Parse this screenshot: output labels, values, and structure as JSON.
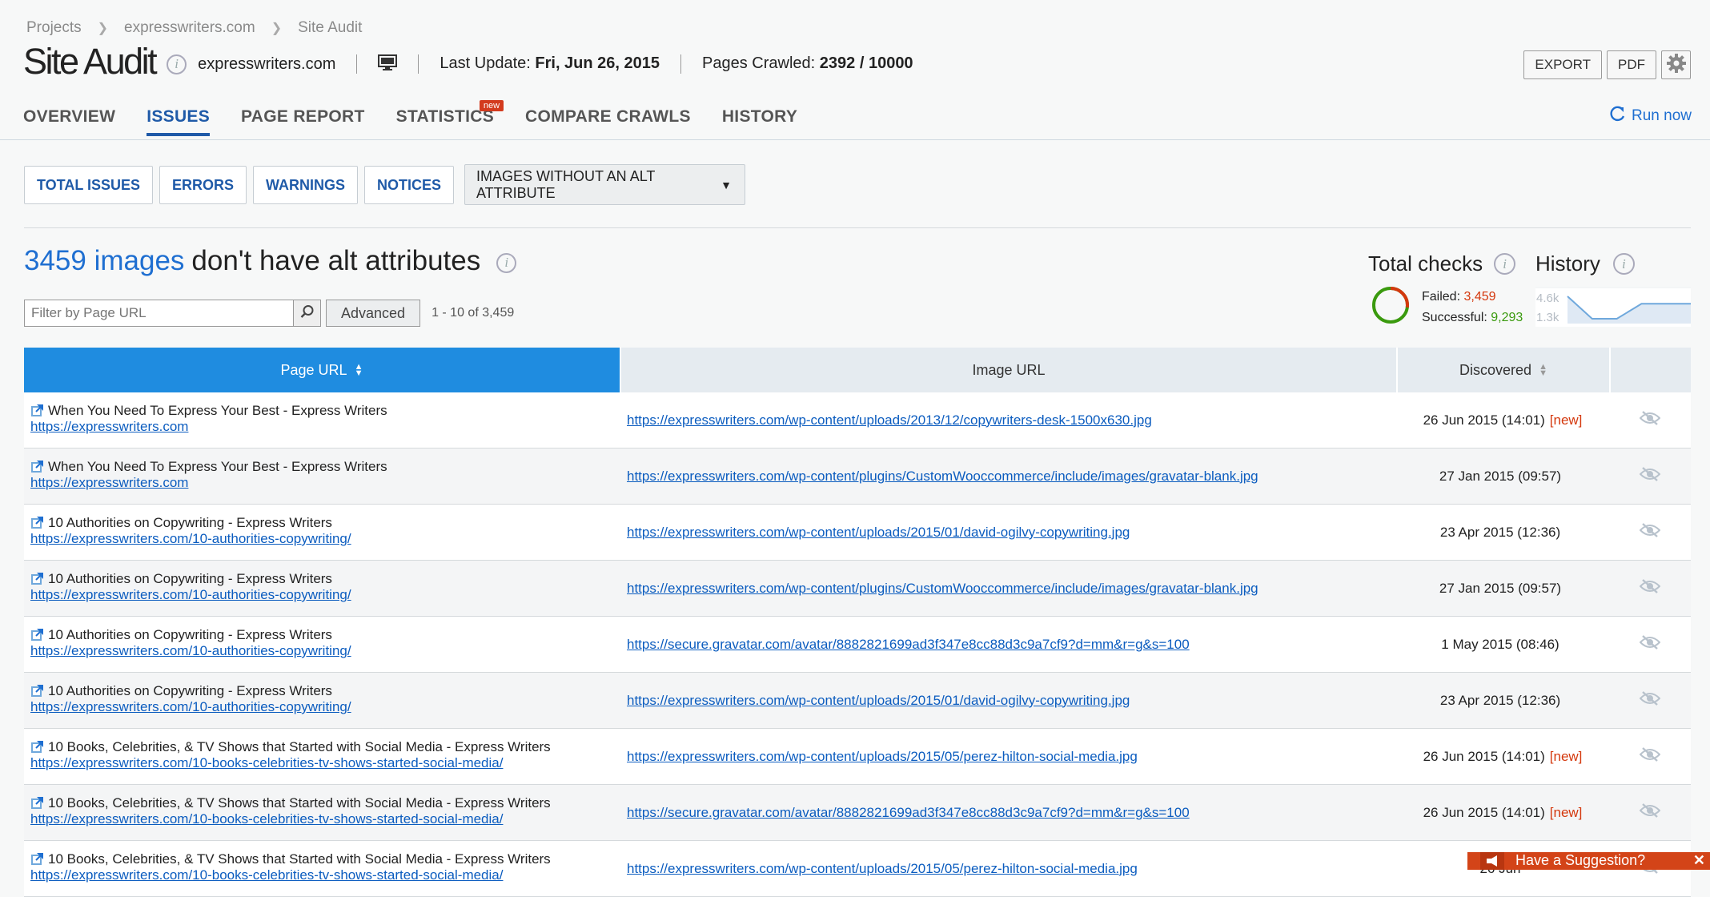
{
  "breadcrumb": [
    "Projects",
    "expresswriters.com",
    "Site Audit"
  ],
  "header": {
    "title": "Site Audit",
    "domain": "expresswriters.com",
    "last_update_label": "Last Update:",
    "last_update_value": "Fri, Jun 26, 2015",
    "pages_crawled_label": "Pages Crawled:",
    "pages_crawled_value": "2392 / 10000"
  },
  "actions": {
    "export": "EXPORT",
    "pdf": "PDF"
  },
  "tabs": [
    {
      "label": "OVERVIEW"
    },
    {
      "label": "ISSUES",
      "active": true
    },
    {
      "label": "PAGE REPORT"
    },
    {
      "label": "STATISTICS",
      "badge": "new"
    },
    {
      "label": "COMPARE CRAWLS"
    },
    {
      "label": "HISTORY"
    }
  ],
  "run_now": "Run now",
  "filters": [
    "TOTAL ISSUES",
    "ERRORS",
    "WARNINGS",
    "NOTICES"
  ],
  "issue_select": "IMAGES WITHOUT AN ALT ATTRIBUTE",
  "headline": {
    "count": "3459 images",
    "text": "don't have alt attributes"
  },
  "search": {
    "placeholder": "Filter by Page URL",
    "advanced": "Advanced",
    "pager": "1 - 10 of 3,459"
  },
  "total_checks": {
    "title": "Total checks",
    "failed_label": "Failed:",
    "failed_value": "3,459",
    "successful_label": "Successful:",
    "successful_value": "9,293",
    "failed": 3459,
    "successful": 9293
  },
  "history": {
    "title": "History",
    "y_top": "4.6k",
    "y_bottom": "1.3k",
    "chart_data": {
      "type": "area",
      "values": [
        4.6,
        1.3,
        1.3,
        3.5,
        3.5,
        3.5
      ],
      "ylim": [
        1.3,
        4.6
      ]
    }
  },
  "table": {
    "columns": [
      "Page URL",
      "Image URL",
      "Discovered"
    ],
    "rows": [
      {
        "title": "When You Need To Express Your Best - Express Writers",
        "url": "https://expresswriters.com",
        "image": "https://expresswriters.com/wp-content/uploads/2013/12/copywriters-desk-1500x630.jpg",
        "date": "26 Jun 2015 (14:01)",
        "new": "[new]"
      },
      {
        "title": "When You Need To Express Your Best - Express Writers",
        "url": "https://expresswriters.com",
        "image": "https://expresswriters.com/wp-content/plugins/CustomWooccommerce/include/images/gravatar-blank.jpg",
        "date": "27 Jan 2015 (09:57)",
        "new": ""
      },
      {
        "title": "10 Authorities on Copywriting - Express Writers",
        "url": "https://expresswriters.com/10-authorities-copywriting/",
        "image": "https://expresswriters.com/wp-content/uploads/2015/01/david-ogilvy-copywriting.jpg",
        "date": "23 Apr 2015 (12:36)",
        "new": ""
      },
      {
        "title": "10 Authorities on Copywriting - Express Writers",
        "url": "https://expresswriters.com/10-authorities-copywriting/",
        "image": "https://expresswriters.com/wp-content/plugins/CustomWooccommerce/include/images/gravatar-blank.jpg",
        "date": "27 Jan 2015 (09:57)",
        "new": ""
      },
      {
        "title": "10 Authorities on Copywriting - Express Writers",
        "url": "https://expresswriters.com/10-authorities-copywriting/",
        "image": "https://secure.gravatar.com/avatar/8882821699ad3f347e8cc88d3c9a7cf9?d=mm&r=g&s=100",
        "date": "1 May 2015 (08:46)",
        "new": ""
      },
      {
        "title": "10 Authorities on Copywriting - Express Writers",
        "url": "https://expresswriters.com/10-authorities-copywriting/",
        "image": "https://expresswriters.com/wp-content/uploads/2015/01/david-ogilvy-copywriting.jpg",
        "date": "23 Apr 2015 (12:36)",
        "new": ""
      },
      {
        "title": "10 Books, Celebrities, & TV Shows that Started with Social Media - Express Writers",
        "url": "https://expresswriters.com/10-books-celebrities-tv-shows-started-social-media/",
        "image": "https://expresswriters.com/wp-content/uploads/2015/05/perez-hilton-social-media.jpg",
        "date": "26 Jun 2015 (14:01)",
        "new": "[new]"
      },
      {
        "title": "10 Books, Celebrities, & TV Shows that Started with Social Media - Express Writers",
        "url": "https://expresswriters.com/10-books-celebrities-tv-shows-started-social-media/",
        "image": "https://secure.gravatar.com/avatar/8882821699ad3f347e8cc88d3c9a7cf9?d=mm&r=g&s=100",
        "date": "26 Jun 2015 (14:01)",
        "new": "[new]"
      },
      {
        "title": "10 Books, Celebrities, & TV Shows that Started with Social Media - Express Writers",
        "url": "https://expresswriters.com/10-books-celebrities-tv-shows-started-social-media/",
        "image": "https://expresswriters.com/wp-content/uploads/2015/05/perez-hilton-social-media.jpg",
        "date": "26 Jun",
        "new": ""
      }
    ]
  },
  "suggestion": "Have a Suggestion?",
  "colors": {
    "accent": "#1f8ce0",
    "tab_active": "#1f5aa8",
    "failed": "#d4380d",
    "successful": "#3a9a0e",
    "new": "#d4380d",
    "suggest": "#d34418"
  }
}
